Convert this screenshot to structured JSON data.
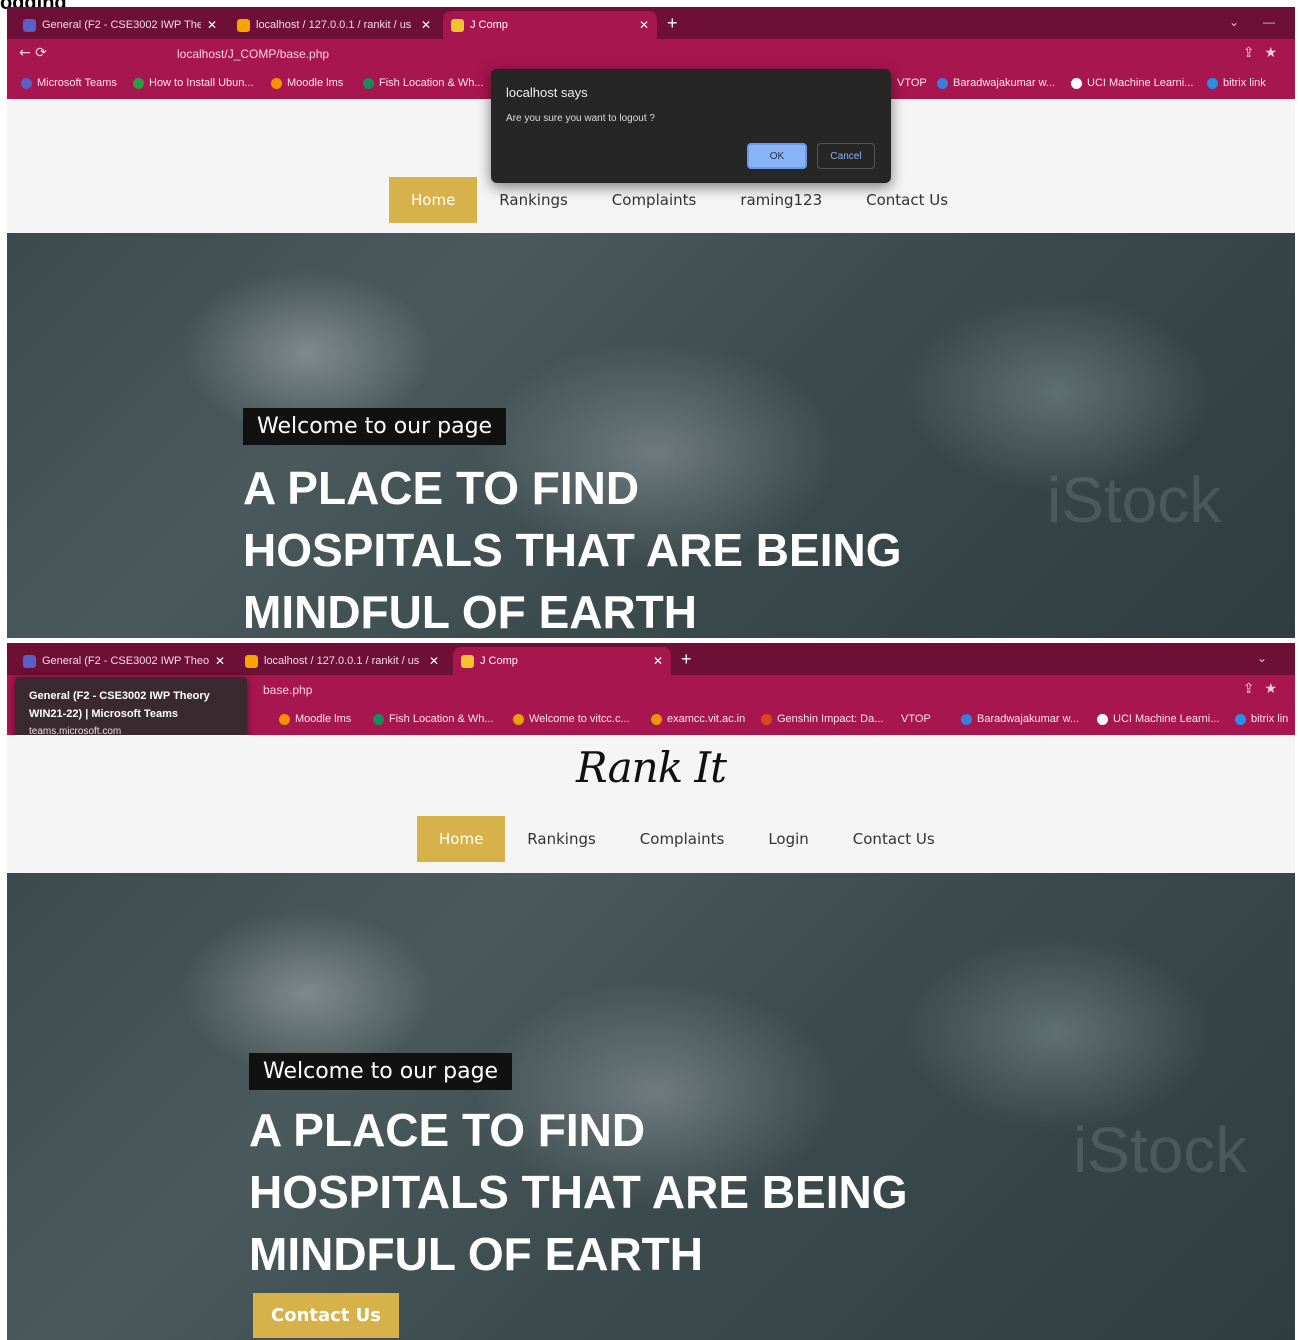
{
  "caption": "ogging",
  "tabs": [
    {
      "title": "General (F2 - CSE3002 IWP Theo",
      "icon": "teams-icon"
    },
    {
      "title": "localhost / 127.0.0.1 / rankit / us",
      "icon": "phpmyadmin-icon"
    },
    {
      "title": "J Comp",
      "icon": "jcomp-icon"
    }
  ],
  "url1": "localhost/J_COMP/base.php",
  "url2": "base.php",
  "bookmarks1": [
    "Microsoft Teams",
    "How to Install Ubun...",
    "Moodle lms",
    "Fish Location & Wh...",
    "VTOP",
    "Baradwajakumar w...",
    "UCI Machine Learni...",
    "bitrix link"
  ],
  "bookmarks2": [
    "Moodle lms",
    "Fish Location & Wh...",
    "Welcome to vitcc.c...",
    "examcc.vit.ac.in",
    "Genshin Impact: Da...",
    "VTOP",
    "Baradwajakumar w...",
    "UCI Machine Learni...",
    "bitrix lin"
  ],
  "tooltip": {
    "line1": "General (F2 - CSE3002 IWP Theory",
    "line2": "WIN21-22) | Microsoft Teams",
    "line3": "teams.microsoft.com"
  },
  "dialog": {
    "title": "localhost says",
    "message": "Are you sure you want to logout ?",
    "ok": "OK",
    "cancel": "Cancel"
  },
  "site": {
    "logo": "Rank It",
    "nav1": [
      "Home",
      "Rankings",
      "Complaints",
      "raming123",
      "Contact Us"
    ],
    "nav2": [
      "Home",
      "Rankings",
      "Complaints",
      "Login",
      "Contact Us"
    ],
    "welcome": "Welcome to our page",
    "headline": [
      "A PLACE TO FIND",
      "HOSPITALS THAT ARE BEING",
      "MINDFUL OF EARTH"
    ],
    "cta": "Contact Us",
    "watermark": "iStock"
  }
}
